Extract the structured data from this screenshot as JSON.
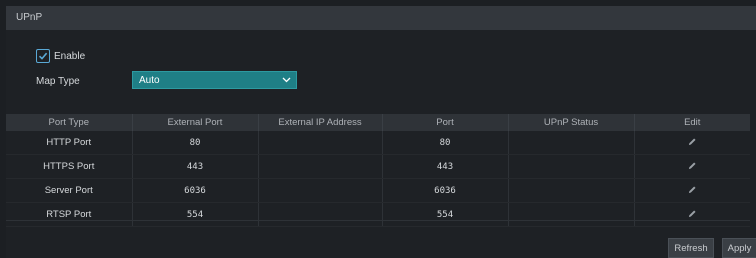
{
  "header": {
    "title": "UPnP"
  },
  "enable": {
    "label": "Enable",
    "checked": true
  },
  "map_type": {
    "label": "Map Type",
    "value": "Auto"
  },
  "table": {
    "columns": [
      "Port Type",
      "External Port",
      "External IP Address",
      "Port",
      "UPnP Status",
      "Edit"
    ],
    "rows": [
      {
        "port_type": "HTTP Port",
        "external_port": "80",
        "external_ip": "",
        "port": "80",
        "status": ""
      },
      {
        "port_type": "HTTPS Port",
        "external_port": "443",
        "external_ip": "",
        "port": "443",
        "status": ""
      },
      {
        "port_type": "Server Port",
        "external_port": "6036",
        "external_ip": "",
        "port": "6036",
        "status": ""
      },
      {
        "port_type": "RTSP Port",
        "external_port": "554",
        "external_ip": "",
        "port": "554",
        "status": ""
      }
    ]
  },
  "buttons": {
    "refresh": "Refresh",
    "apply": "Apply"
  },
  "colors": {
    "accent": "#1f7f86",
    "check": "#5aa9d6",
    "background": "#1e2125"
  }
}
